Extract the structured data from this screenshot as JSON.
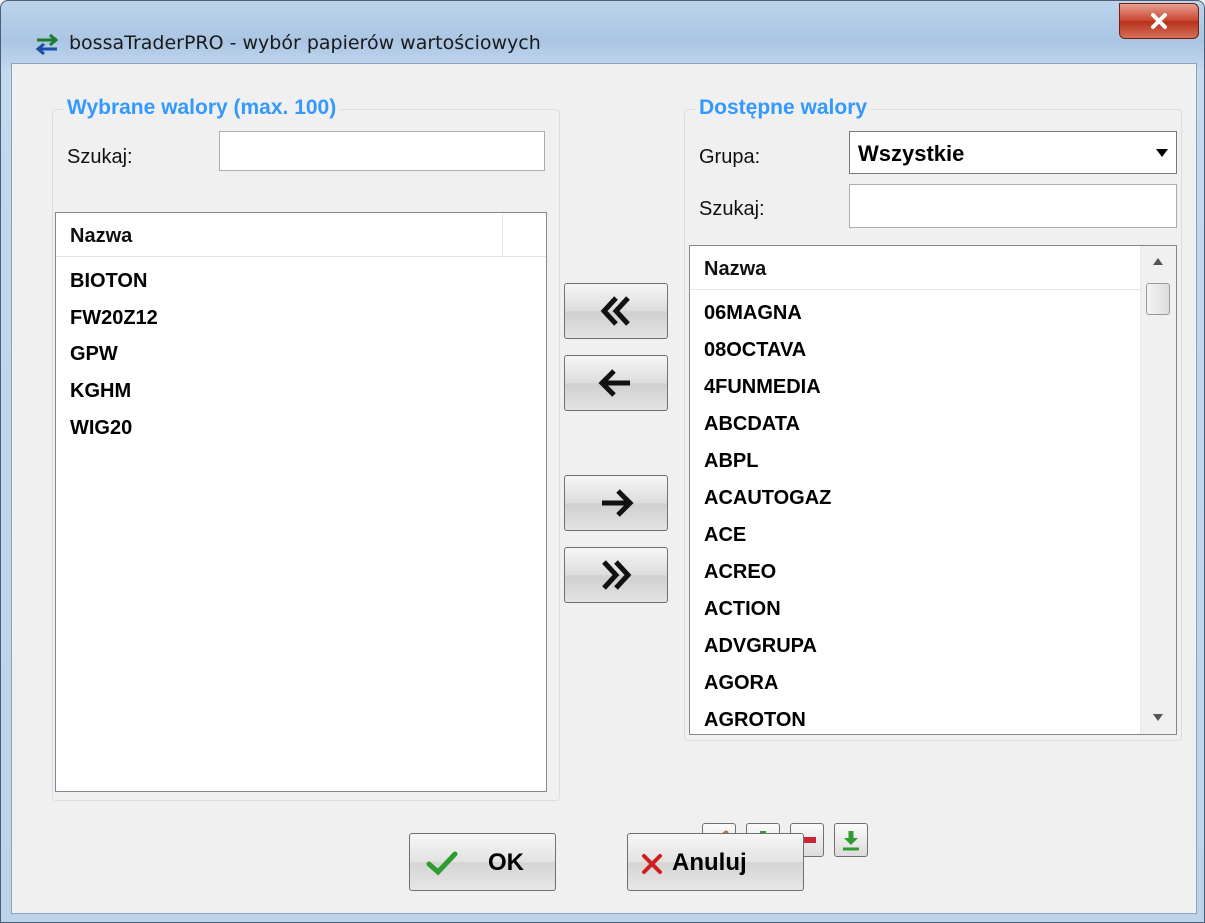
{
  "window": {
    "title": "bossaTraderPRO - wybór papierów wartościowych",
    "close_label": "x"
  },
  "left_group": {
    "title": "Wybrane walory (max. 100)",
    "search_label": "Szukaj:",
    "search_value": "",
    "column_header": "Nazwa",
    "items": [
      "BIOTON",
      "FW20Z12",
      "GPW",
      "KGHM",
      "WIG20"
    ]
  },
  "right_group": {
    "title": "Dostępne walory",
    "group_label": "Grupa:",
    "group_value": "Wszystkie",
    "search_label": "Szukaj:",
    "search_value": "",
    "column_header": "Nazwa",
    "items": [
      "06MAGNA",
      "08OCTAVA",
      "4FUNMEDIA",
      "ABCDATA",
      "ABPL",
      "ACAUTOGAZ",
      "ACE",
      "ACREO",
      "ACTION",
      "ADVGRUPA",
      "AGORA",
      "AGROTON"
    ]
  },
  "buttons": {
    "ok": "OK",
    "cancel": "Anuluj"
  },
  "icons": {
    "move_all_left": "double-chevron-left-icon",
    "move_left": "arrow-left-icon",
    "move_right": "arrow-right-icon",
    "move_all_right": "double-chevron-right-icon",
    "edit": "pencil-icon",
    "add": "plus-icon",
    "remove": "minus-icon",
    "download": "download-icon"
  },
  "colors": {
    "group_title": "#3399ff",
    "close": "#c9442c",
    "plus": "#2e9c2e",
    "minus": "#c8243a",
    "ok_check": "#2e9c2e",
    "cancel_x": "#d21e1e"
  }
}
